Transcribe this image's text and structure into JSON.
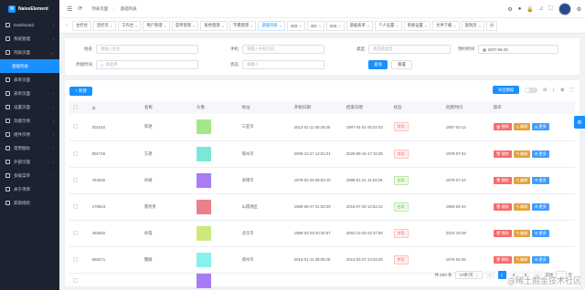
{
  "brand": {
    "name": "NaiveElement"
  },
  "sidebar": {
    "items": [
      {
        "label": "Dashboard",
        "arrow": "›"
      },
      {
        "label": "系统管理",
        "arrow": "›"
      },
      {
        "label": "列表页面",
        "arrow": "⌄"
      },
      {
        "label": "基础列表",
        "sub": true,
        "active": true
      },
      {
        "label": "表单页面",
        "arrow": "›"
      },
      {
        "label": "表单页面",
        "arrow": "›"
      },
      {
        "label": "设置页面",
        "arrow": "›"
      },
      {
        "label": "功能示例",
        "arrow": "›"
      },
      {
        "label": "组件示例",
        "arrow": "›"
      },
      {
        "label": "常用图标",
        "arrow": "›"
      },
      {
        "label": "外部页面",
        "arrow": "›"
      },
      {
        "label": "多级菜单",
        "arrow": "›"
      },
      {
        "label": "关于项目",
        "arrow": ""
      },
      {
        "label": "获取授权",
        "arrow": ""
      }
    ]
  },
  "header": {
    "breadcrumb": [
      "列表页面",
      "基础列表"
    ]
  },
  "tabs": [
    {
      "label": "主控台"
    },
    {
      "label": "监控页"
    },
    {
      "label": "工作台"
    },
    {
      "label": "用户管理"
    },
    {
      "label": "菜单管理"
    },
    {
      "label": "角色管理"
    },
    {
      "label": "字典管理"
    },
    {
      "label": "基础列表",
      "active": true
    },
    {
      "label": "403"
    },
    {
      "label": "404"
    },
    {
      "label": "500"
    },
    {
      "label": "基础表单"
    },
    {
      "label": "个人设置"
    },
    {
      "label": "系统设置"
    },
    {
      "label": "文件下载"
    },
    {
      "label": "复制页"
    },
    {
      "label": "分"
    }
  ],
  "filters": {
    "row1": [
      {
        "label": "姓名",
        "placeholder": "请输入姓名"
      },
      {
        "label": "手机",
        "placeholder": "请输入手机号码"
      },
      {
        "label": "类型",
        "placeholder": "请选择类型"
      },
      {
        "label": "预约时间",
        "placeholder": "2007-06-30"
      }
    ],
    "row2": [
      {
        "label": "停留时间",
        "placeholder": "请选择"
      },
      {
        "label": "状态",
        "placeholder": "请输入"
      }
    ],
    "query_label": "查询",
    "reset_label": "重置"
  },
  "toolbar": {
    "add_label": "+ 新建",
    "export_label": "导出数据"
  },
  "table": {
    "columns": [
      "id",
      "名称",
      "头像",
      "地址",
      "开始日期",
      "结束日期",
      "状态",
      "创建时间",
      "操作"
    ],
    "rows": [
      {
        "id": "001532",
        "name": "郭艳",
        "color": "#a4e787",
        "address": "三亚市",
        "start": "2012-01-11 06:26:40",
        "end": "1997-04-01 05:02:43",
        "status": "禁用",
        "status_type": "red",
        "created": "1997-02-12"
      },
      {
        "id": "801746",
        "name": "方艳",
        "color": "#7ae8d9",
        "address": "锦州市",
        "start": "2006-12-27 12:01:21",
        "end": "2028-09-15 17:16:38",
        "status": "禁用",
        "status_type": "red",
        "created": "1979-07-02"
      },
      {
        "id": "784635",
        "name": "孙娟",
        "color": "#a87cf3",
        "address": "承德市",
        "start": "1979-02-25 06:03:10",
        "end": "1989-01-21 11:53:29",
        "status": "启用",
        "status_type": "green",
        "created": "1975-07-24"
      },
      {
        "id": "175563",
        "name": "雷秀英",
        "color": "#ec7f8c",
        "address": "山南地区",
        "start": "1985-08-27 01:03:29",
        "end": "2016-07-25 14:52:12",
        "status": "启用",
        "status_type": "green",
        "created": "1983-04-24"
      },
      {
        "id": "465692",
        "name": "孙霞",
        "color": "#cde97a",
        "address": "北京市",
        "start": "1986-03-29 20:34:57",
        "end": "2002-12-25 02:37:08",
        "status": "禁用",
        "status_type": "red",
        "created": "2010-10-29"
      },
      {
        "id": "568271",
        "name": "魏娟",
        "color": "#86f2ec",
        "address": "郑州市",
        "start": "2016-01-11 09:08:25",
        "end": "2013-03-27 23:03:29",
        "status": "禁用",
        "status_type": "red",
        "created": "1976-02-06"
      },
      {
        "id": "",
        "name": "",
        "color": "#a87cf3",
        "address": "",
        "start": "",
        "end": "",
        "status": "",
        "status_type": "",
        "created": ""
      }
    ],
    "actions": {
      "delete": "删除",
      "edit": "编辑",
      "more": "更多"
    }
  },
  "pager": {
    "total": "共 600 条",
    "page_size": "10条/页",
    "pages": [
      "1",
      "2",
      "3"
    ],
    "current": "1",
    "goto_label": "前往",
    "goto_suffix": "页"
  },
  "watermark": "@稀土掘金技术社区",
  "colors": {
    "primary": "#1890ff",
    "sidebar_bg": "#1d2230",
    "danger": "#f56c6c",
    "warning": "#e6a23c"
  }
}
